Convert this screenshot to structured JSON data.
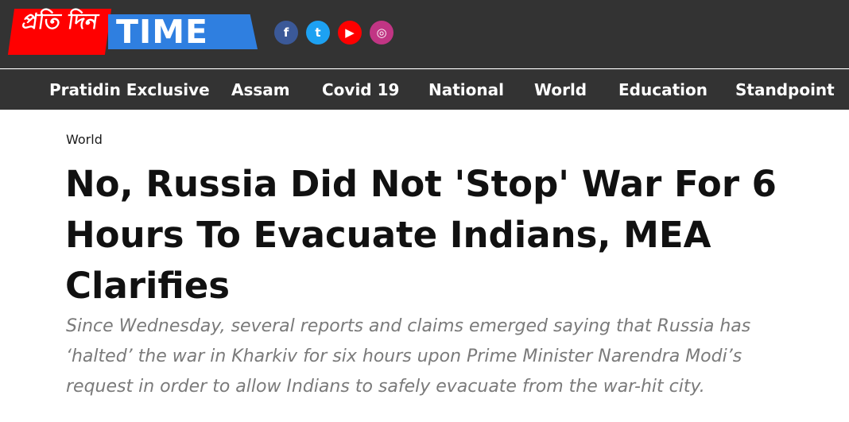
{
  "brand": {
    "logo_bengali": "প্রতি দিন",
    "logo_time": "TIME",
    "colors": {
      "red": "#ff0000",
      "blue": "#2f7fe0",
      "header_bg": "#333333"
    }
  },
  "social": [
    {
      "name": "facebook-icon",
      "glyph": "f"
    },
    {
      "name": "twitter-icon",
      "glyph": "t"
    },
    {
      "name": "youtube-icon",
      "glyph": "▶"
    },
    {
      "name": "instagram-icon",
      "glyph": "◎"
    }
  ],
  "nav": {
    "items": [
      "Pratidin Exclusive",
      "Assam",
      "Covid 19",
      "National",
      "World",
      "Education",
      "Standpoint"
    ]
  },
  "article": {
    "category": "World",
    "headline": "No, Russia Did Not 'Stop' War For 6 Hours To Evacuate Indians, MEA Clarifies",
    "summary": "Since Wednesday, several reports and claims emerged saying that Russia has ‘halted’ the war in Kharkiv for six hours upon Prime Minister Narendra Modi’s request in order to allow Indians to safely evacuate from the war-hit city."
  }
}
